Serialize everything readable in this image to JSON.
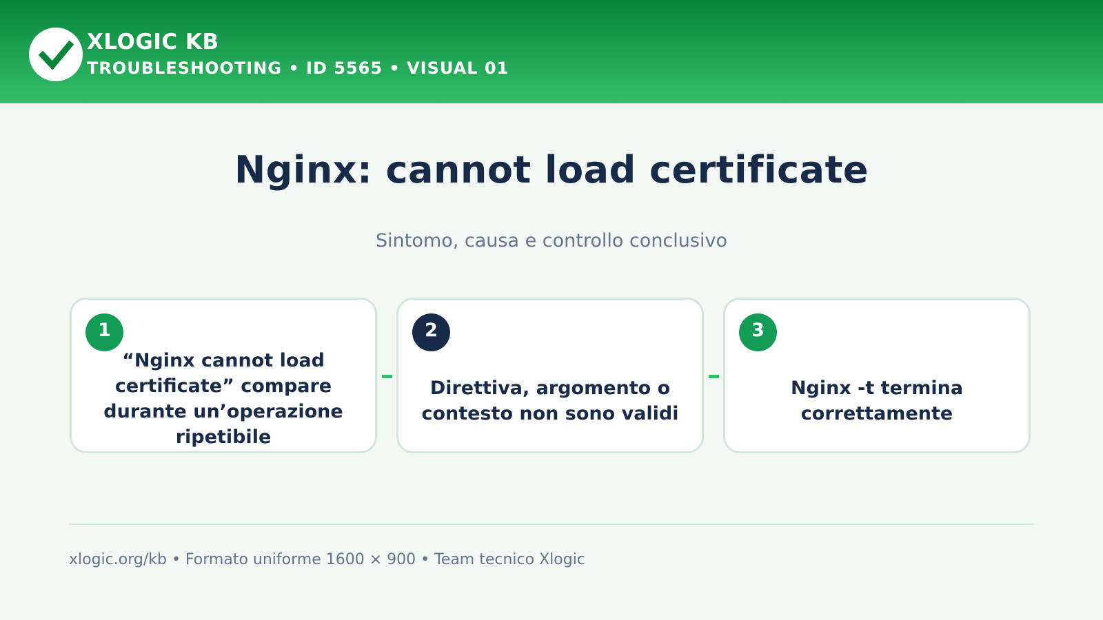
{
  "header": {
    "brand": "XLOGIC KB",
    "subtitle": "TROUBLESHOOTING • ID 5565 • VISUAL 01",
    "logo_icon": "checkmark-icon",
    "colors": {
      "gradient_top": "#06843a",
      "gradient_bottom": "#35bf6a"
    }
  },
  "main": {
    "title": "Nginx: cannot load certificate",
    "subtitle": "Sintomo, causa e controllo conclusivo"
  },
  "steps": [
    {
      "number": "1",
      "text": "“Nginx cannot load certificate” compare durante un’operazione ripetibile",
      "badge_color": "#139c56"
    },
    {
      "number": "2",
      "text": "Direttiva, argomento o contesto non sono validi",
      "badge_color": "#172b48"
    },
    {
      "number": "3",
      "text": "Nginx -t termina correttamente",
      "badge_color": "#139c56"
    }
  ],
  "footer": {
    "text": "xlogic.org/kb • Formato uniforme 1600 × 900 • Team tecnico Xlogic"
  }
}
